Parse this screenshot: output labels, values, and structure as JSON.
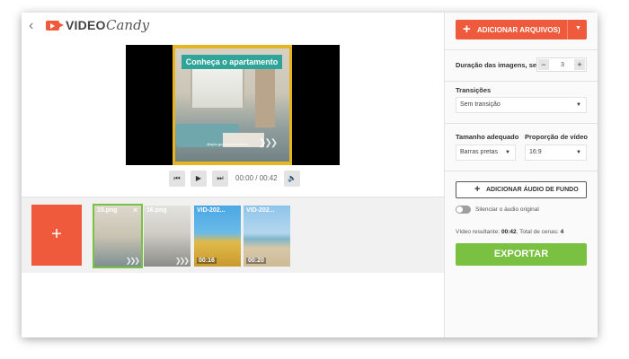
{
  "header": {
    "back_icon": "chevron-left-icon",
    "logo_icon": "video-camera-icon",
    "logo_word1": "VIDEO",
    "logo_word2": "Candy"
  },
  "preview": {
    "banner": "Conheça o apartamento",
    "watermark": "@apto.guarujadosadassa",
    "arrows": "❯❯❯"
  },
  "player": {
    "prev_icon": "skip-previous-icon",
    "play_icon": "play-icon",
    "next_icon": "skip-next-icon",
    "volume_icon": "volume-icon",
    "prev_glyph": "⏮",
    "play_glyph": "▶",
    "next_glyph": "⏭",
    "volume_glyph": "🔈",
    "time": "00:00 / 00:42"
  },
  "timeline": {
    "add_label": "+",
    "clips": [
      {
        "label": "15.png",
        "duration": "",
        "selected": true,
        "close": "✕",
        "arrows": "❯❯❯"
      },
      {
        "label": "16.png",
        "duration": "",
        "selected": false,
        "close": "",
        "arrows": "❯❯❯"
      },
      {
        "label": "VID-202...",
        "duration": "00:16",
        "selected": false,
        "close": "",
        "arrows": ""
      },
      {
        "label": "VID-202...",
        "duration": "00:20",
        "selected": false,
        "close": "",
        "arrows": ""
      }
    ]
  },
  "panel": {
    "add_files_label": "ADICIONAR ARQUIVOS)",
    "add_files_plus": "+",
    "add_files_caret": "▼",
    "image_duration_label": "Duração das imagens, seg",
    "image_duration_value": "3",
    "minus": "−",
    "plus": "+",
    "transitions_label": "Transições",
    "transitions_value": "Sem transição",
    "fit_label": "Tamanho adequado",
    "fit_value": "Barras pretas",
    "ratio_label": "Proporção de vídeo",
    "ratio_value": "16:9",
    "select_arrow": "▼",
    "audio_plus": "+",
    "audio_button": "ADICIONAR ÁUDIO DE FUNDO",
    "mute_label": "Silenciar o áudio original",
    "result_prefix": "Vídeo resultante: ",
    "result_duration": "00:42",
    "result_scenes_prefix": ", Total de cenas: ",
    "result_scenes": "4",
    "export_label": "EXPORTAR"
  },
  "colors": {
    "accent": "#ef5a3c",
    "export": "#7ac142",
    "banner": "#2fa59a",
    "frame": "#e7b422"
  }
}
